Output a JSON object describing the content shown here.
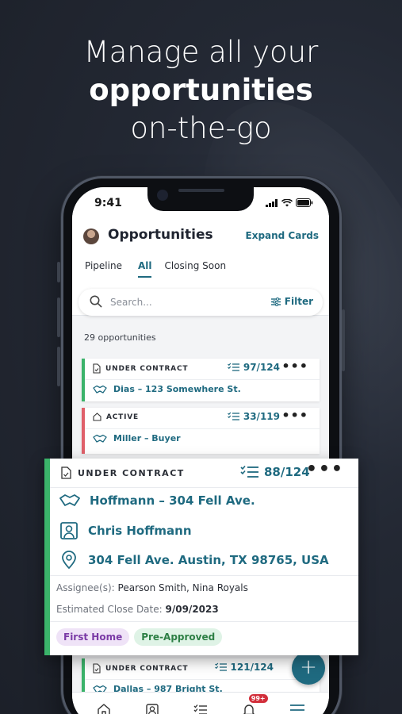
{
  "headline": {
    "line1": "Manage all your",
    "line2": "opportunities",
    "line3": "on-the-go"
  },
  "status_bar": {
    "time": "9:41"
  },
  "header": {
    "title": "Opportunities",
    "expand_label": "Expand Cards"
  },
  "tabs": [
    {
      "label": "Pipeline",
      "active": false
    },
    {
      "label": "All",
      "active": true
    },
    {
      "label": "Closing Soon",
      "active": false
    }
  ],
  "search": {
    "placeholder": "Search...",
    "filter_label": "Filter"
  },
  "count_label": "29 opportunities",
  "cards": [
    {
      "status": "UNDER CONTRACT",
      "tasks": "97/124",
      "name": "Dias – 123 Somewhere St.",
      "accent": "#3bb36a"
    },
    {
      "status": "ACTIVE",
      "tasks": "33/119",
      "name": "Miller – Buyer",
      "accent": "#e0606a"
    },
    {
      "status": "UNDER CONTRACT",
      "tasks": "121/124",
      "name": "Dallas – 987 Bright St.",
      "accent": "#3bb36a"
    }
  ],
  "expanded_card": {
    "status": "UNDER CONTRACT",
    "tasks": "88/124",
    "name": "Hoffmann – 304 Fell Ave.",
    "contact": "Chris Hoffmann",
    "address": "304 Fell Ave. Austin, TX 98765, USA",
    "assignees_label": "Assignee(s):",
    "assignees_value": "Pearson Smith, Nina Royals",
    "close_label": "Estimated Close Date:",
    "close_value": "9/09/2023",
    "tags": [
      "First Home",
      "Pre-Approved"
    ]
  },
  "bottom_nav": {
    "items": [
      "home-icon",
      "contact-icon",
      "tasks-icon",
      "bell-icon",
      "menu-icon"
    ],
    "badge": "99+"
  },
  "fab_label": "+",
  "colors": {
    "accent": "#1f6a80",
    "green": "#3bb36a",
    "red": "#e0606a"
  }
}
